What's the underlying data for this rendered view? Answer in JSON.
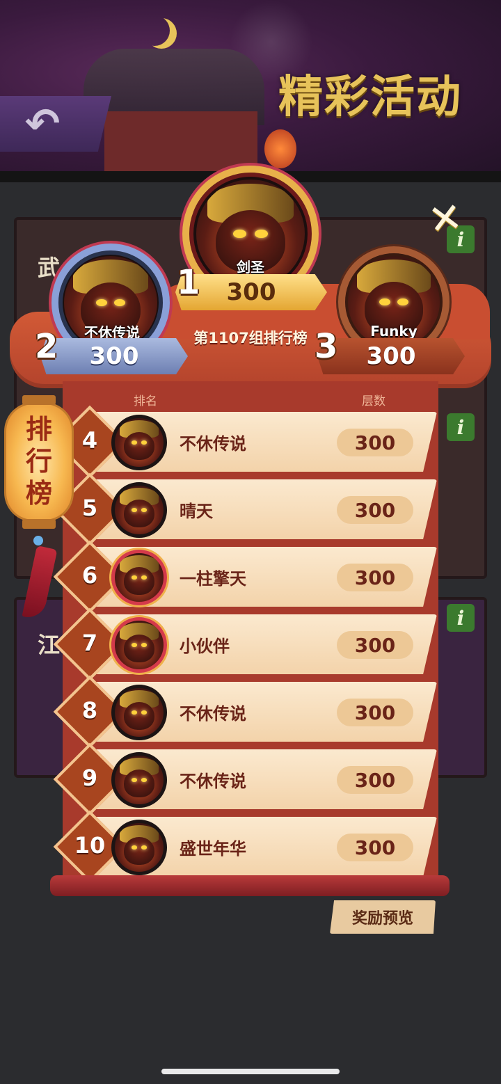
{
  "header": {
    "title": "精彩活动"
  },
  "background": {
    "panel_labels": [
      "武",
      "江"
    ]
  },
  "board": {
    "group_title": "第1107组排行榜",
    "side_label": "排行榜",
    "columns": {
      "rank": "排名",
      "score": "层数"
    },
    "reward_button": "奖励预览"
  },
  "podium": [
    {
      "place": "1",
      "name": "剑圣",
      "score": "300"
    },
    {
      "place": "2",
      "name": "不休传说",
      "score": "300"
    },
    {
      "place": "3",
      "name": "Funky",
      "score": "300"
    }
  ],
  "rows": [
    {
      "rank": "4",
      "name": "不休传说",
      "score": "300",
      "frame": "plain"
    },
    {
      "rank": "5",
      "name": "晴天",
      "score": "300",
      "frame": "plain"
    },
    {
      "rank": "6",
      "name": "一柱擎天",
      "score": "300",
      "frame": "fancy"
    },
    {
      "rank": "7",
      "name": "小伙伴",
      "score": "300",
      "frame": "fancy"
    },
    {
      "rank": "8",
      "name": "不休传说",
      "score": "300",
      "frame": "plain"
    },
    {
      "rank": "9",
      "name": "不休传说",
      "score": "300",
      "frame": "plain"
    },
    {
      "rank": "10",
      "name": "盛世年华",
      "score": "300",
      "frame": "plain"
    }
  ],
  "icons": {
    "back": "back-arrow-icon",
    "close": "close-icon",
    "info": "info-icon"
  }
}
